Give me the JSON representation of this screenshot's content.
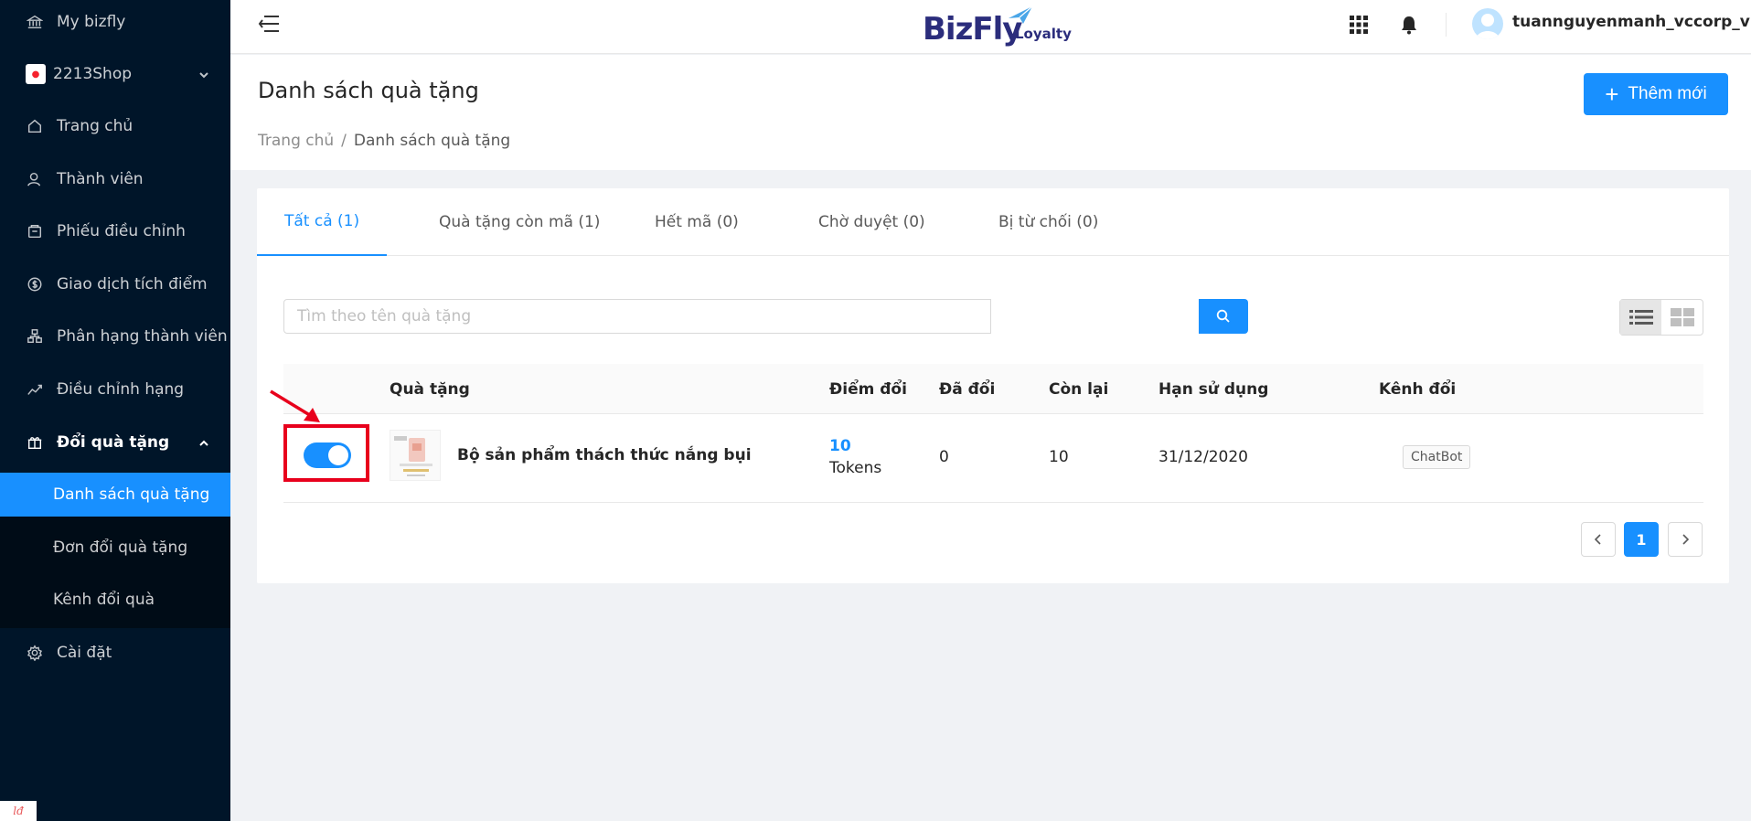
{
  "sidebar": {
    "top_item": "My bizfly",
    "shop": "2213Shop",
    "items": [
      {
        "label": "Trang chủ"
      },
      {
        "label": "Thành viên"
      },
      {
        "label": "Phiếu điều chỉnh"
      },
      {
        "label": "Giao dịch tích điểm"
      },
      {
        "label": "Phân hạng thành viên"
      },
      {
        "label": "Điều chỉnh hạng"
      },
      {
        "label": "Đổi quà tặng"
      },
      {
        "label": "Cài đặt"
      }
    ],
    "submenu": [
      {
        "label": "Danh sách quà tặng"
      },
      {
        "label": "Đơn đổi quà tặng"
      },
      {
        "label": "Kênh đổi quà"
      }
    ]
  },
  "header": {
    "logo_main": "BizFly",
    "logo_sub": "Loyalty",
    "username": "tuannguyenmanh_vccorp_vn"
  },
  "page": {
    "title": "Danh sách quà tặng",
    "breadcrumb": [
      "Trang chủ",
      "Danh sách quà tặng"
    ],
    "breadcrumb_sep": "/",
    "add_button": "Thêm mới"
  },
  "tabs": [
    {
      "label": "Tất cả (1)"
    },
    {
      "label": "Quà tặng còn mã (1)"
    },
    {
      "label": "Hết mã (0)"
    },
    {
      "label": "Chờ duyệt (0)"
    },
    {
      "label": "Bị từ chối (0)"
    }
  ],
  "search": {
    "placeholder": "Tìm theo tên quà tặng"
  },
  "table": {
    "columns": [
      "Quà tặng",
      "Điểm đổi",
      "Đã đổi",
      "Còn lại",
      "Hạn sử dụng",
      "Kênh đổi"
    ],
    "rows": [
      {
        "name": "Bộ sản phẩm thách thức nắng bụi",
        "points": "10",
        "points_unit": "Tokens",
        "redeemed": "0",
        "remaining": "10",
        "expiry": "31/12/2020",
        "channel": "ChatBot"
      }
    ]
  },
  "pagination": {
    "current": "1"
  },
  "colors": {
    "primary": "#1890ff",
    "sidebar": "#001529",
    "highlight": "#e8001c"
  }
}
